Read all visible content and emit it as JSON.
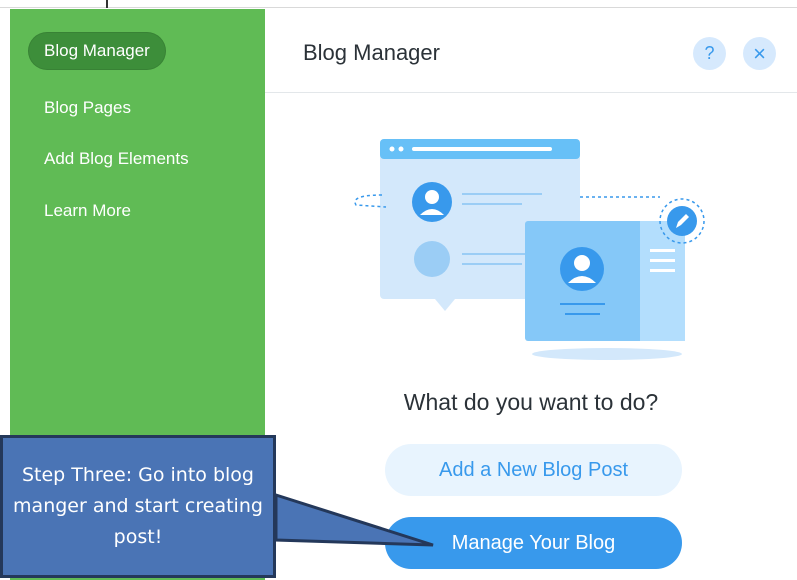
{
  "sidebar": {
    "items": [
      {
        "label": "Blog Manager",
        "active": true
      },
      {
        "label": "Blog Pages"
      },
      {
        "label": "Add Blog Elements"
      },
      {
        "label": "Learn More"
      }
    ]
  },
  "panel": {
    "title": "Blog Manager",
    "help_icon": "?",
    "close_icon": "×",
    "question": "What do you want to do?",
    "secondary_button": "Add a New Blog Post",
    "primary_button": "Manage Your Blog"
  },
  "callout": {
    "text": "Step Three: Go into blog manger and start creating post!"
  },
  "colors": {
    "sidebar": "#60bb55",
    "sidebar_active": "#3d8e3a",
    "accent": "#3899ec",
    "accent_light": "#e8f4fe",
    "callout": "#4a74b5"
  },
  "icons": [
    "question-mark-icon",
    "close-icon",
    "pencil-icon",
    "user-avatar-icon"
  ]
}
